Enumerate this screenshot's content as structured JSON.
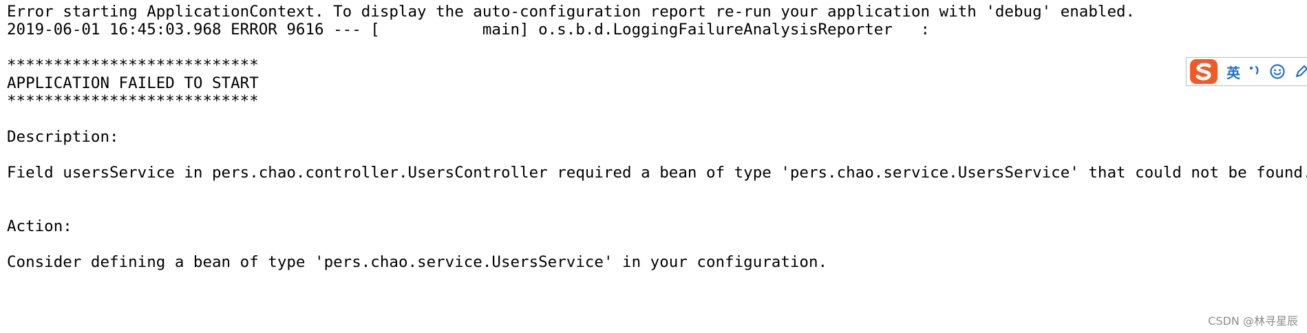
{
  "console": {
    "lines": [
      "Error starting ApplicationContext. To display the auto-configuration report re-run your application with 'debug' enabled.",
      "2019-06-01 16:45:03.968 ERROR 9616 --- [           main] o.s.b.d.LoggingFailureAnalysisReporter   : ",
      "",
      "***************************",
      "APPLICATION FAILED TO START",
      "***************************",
      "",
      "Description:",
      "",
      "Field usersService in pers.chao.controller.UsersController required a bean of type 'pers.chao.service.UsersService' that could not be found.",
      "",
      "",
      "Action:",
      "",
      "Consider defining a bean of type 'pers.chao.service.UsersService' in your configuration."
    ]
  },
  "ime_toolbar": {
    "logo_icon": "sogou-s-logo-icon",
    "logo_color": "#f15a24",
    "language_label": "英",
    "accent_color": "#1d6fd4",
    "items": [
      "punctuation-icon",
      "emoji-smile-icon",
      "pen-icon"
    ]
  },
  "watermark": {
    "text": "CSDN @林寻星辰"
  }
}
